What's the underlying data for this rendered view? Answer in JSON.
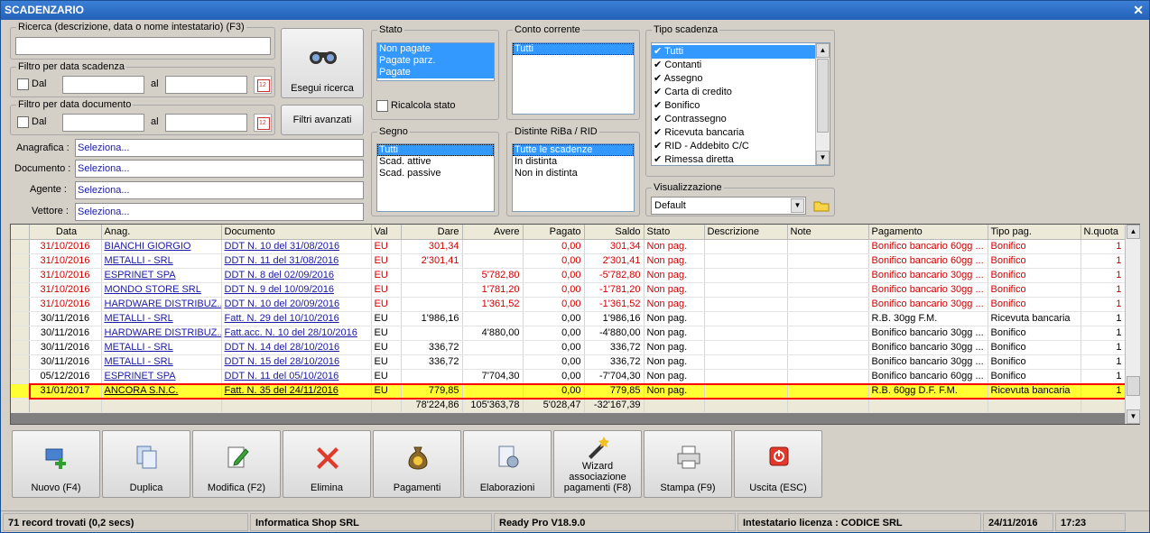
{
  "window": {
    "title": "SCADENZARIO",
    "close_glyph": "✕"
  },
  "search": {
    "label": "Ricerca (descrizione, data o nome intestatario) (F3)",
    "value": "",
    "filter_due_label": "Filtro per data scadenza",
    "filter_doc_label": "Filtro per data documento",
    "from_label": "Dal",
    "to_label": "al",
    "exec_button": "Esegui ricerca",
    "advanced_button": "Filtri avanzati",
    "anagrafica_label": "Anagrafica :",
    "documento_label": "Documento :",
    "agente_label": "Agente :",
    "vettore_label": "Vettore :",
    "select_placeholder": "Seleziona..."
  },
  "stato": {
    "label": "Stato",
    "items": [
      "Non pagate",
      "Pagate parz.",
      "Pagate"
    ],
    "ricalcola_label": "Ricalcola stato"
  },
  "segno": {
    "label": "Segno",
    "items": [
      "Tutti",
      "Scad. attive",
      "Scad. passive"
    ]
  },
  "conto": {
    "label": "Conto corrente",
    "items": [
      "Tutti"
    ]
  },
  "distinte": {
    "label": "Distinte RiBa / RID",
    "items": [
      "Tutte le scadenze",
      "In distinta",
      "Non in distinta"
    ]
  },
  "tipo": {
    "label": "Tipo scadenza",
    "items": [
      "Tutti",
      "Contanti",
      "Assegno",
      "Carta di credito",
      "Bonifico",
      "Contrassegno",
      "Ricevuta bancaria",
      "RID - Addebito C/C",
      "Rimessa diretta"
    ]
  },
  "visual": {
    "label": "Visualizzazione",
    "value": "Default"
  },
  "grid": {
    "columns": [
      "Data",
      "Anag.",
      "Documento",
      "Val",
      "Dare",
      "Avere",
      "Pagato",
      "Saldo",
      "Stato",
      "Descrizione",
      "Note",
      "Pagamento",
      "Tipo pag.",
      "N.quota"
    ],
    "rows": [
      [
        "31/10/2016",
        "BIANCHI GIORGIO",
        "DDT N. 10 del 31/08/2016",
        "EU",
        "301,34",
        "",
        "0,00",
        "301,34",
        "Non pag.",
        "",
        "",
        "Bonifico bancario 60gg ...",
        "Bonifico",
        "1"
      ],
      [
        "31/10/2016",
        "METALLI - SRL",
        "DDT N. 11 del 31/08/2016",
        "EU",
        "2'301,41",
        "",
        "0,00",
        "2'301,41",
        "Non pag.",
        "",
        "",
        "Bonifico bancario 60gg ...",
        "Bonifico",
        "1"
      ],
      [
        "31/10/2016",
        "ESPRINET SPA",
        "DDT N. 8 del 02/09/2016",
        "EU",
        "",
        "5'782,80",
        "0,00",
        "-5'782,80",
        "Non pag.",
        "",
        "",
        "Bonifico bancario 30gg ...",
        "Bonifico",
        "1"
      ],
      [
        "31/10/2016",
        "MONDO STORE SRL",
        "DDT N. 9 del 10/09/2016",
        "EU",
        "",
        "1'781,20",
        "0,00",
        "-1'781,20",
        "Non pag.",
        "",
        "",
        "Bonifico bancario 30gg ...",
        "Bonifico",
        "1"
      ],
      [
        "31/10/2016",
        "HARDWARE DISTRIBUZ...",
        "DDT N. 10 del 20/09/2016",
        "EU",
        "",
        "1'361,52",
        "0,00",
        "-1'361,52",
        "Non pag.",
        "",
        "",
        "Bonifico bancario 30gg ...",
        "Bonifico",
        "1"
      ],
      [
        "30/11/2016",
        "METALLI - SRL",
        "Fatt. N. 29 del 10/10/2016",
        "EU",
        "1'986,16",
        "",
        "0,00",
        "1'986,16",
        "Non pag.",
        "",
        "",
        "R.B. 30gg F.M.",
        "Ricevuta bancaria",
        "1"
      ],
      [
        "30/11/2016",
        "HARDWARE DISTRIBUZ...",
        "Fatt.acc. N. 10 del 28/10/2016",
        "EU",
        "",
        "4'880,00",
        "0,00",
        "-4'880,00",
        "Non pag.",
        "",
        "",
        "Bonifico bancario 30gg ...",
        "Bonifico",
        "1"
      ],
      [
        "30/11/2016",
        "METALLI - SRL",
        "DDT N. 14 del 28/10/2016",
        "EU",
        "336,72",
        "",
        "0,00",
        "336,72",
        "Non pag.",
        "",
        "",
        "Bonifico bancario 30gg ...",
        "Bonifico",
        "1"
      ],
      [
        "30/11/2016",
        "METALLI - SRL",
        "DDT N. 15 del 28/10/2016",
        "EU",
        "336,72",
        "",
        "0,00",
        "336,72",
        "Non pag.",
        "",
        "",
        "Bonifico bancario 30gg ...",
        "Bonifico",
        "1"
      ],
      [
        "05/12/2016",
        "ESPRINET SPA",
        "DDT N. 11 del 05/10/2016",
        "EU",
        "",
        "7'704,30",
        "0,00",
        "-7'704,30",
        "Non pag.",
        "",
        "",
        "Bonifico bancario 60gg ...",
        "Bonifico",
        "1"
      ],
      [
        "31/01/2017",
        "ANCORA S.N.C.",
        "Fatt. N. 35 del 24/11/2016",
        "EU",
        "779,85",
        "",
        "0,00",
        "779,85",
        "Non pag.",
        "",
        "",
        "R.B. 60gg D.F. F.M.",
        "Ricevuta bancaria",
        "1"
      ]
    ],
    "totals": {
      "dare": "78'224,86",
      "avere": "105'363,78",
      "pagato": "5'028,47",
      "saldo": "-32'167,39"
    }
  },
  "toolbar": {
    "nuovo": "Nuovo (F4)",
    "duplica": "Duplica",
    "modifica": "Modifica (F2)",
    "elimina": "Elimina",
    "pagamenti": "Pagamenti",
    "elaborazioni": "Elaborazioni",
    "wizard_1": "Wizard",
    "wizard_2": "associazione",
    "wizard_3": "pagamenti (F8)",
    "stampa": "Stampa (F9)",
    "uscita": "Uscita (ESC)"
  },
  "status": {
    "records": "71 record trovati (0,2 secs)",
    "company": "Informatica Shop SRL",
    "version": "Ready Pro V18.9.0",
    "license": "Intestatario licenza : CODICE SRL",
    "date": "24/11/2016",
    "time": "17:23"
  },
  "colors": {
    "highlight_row": "#ffff33",
    "highlight_border": "#ff0000",
    "overdue_text": "#d00000",
    "selection": "#3399ff"
  }
}
